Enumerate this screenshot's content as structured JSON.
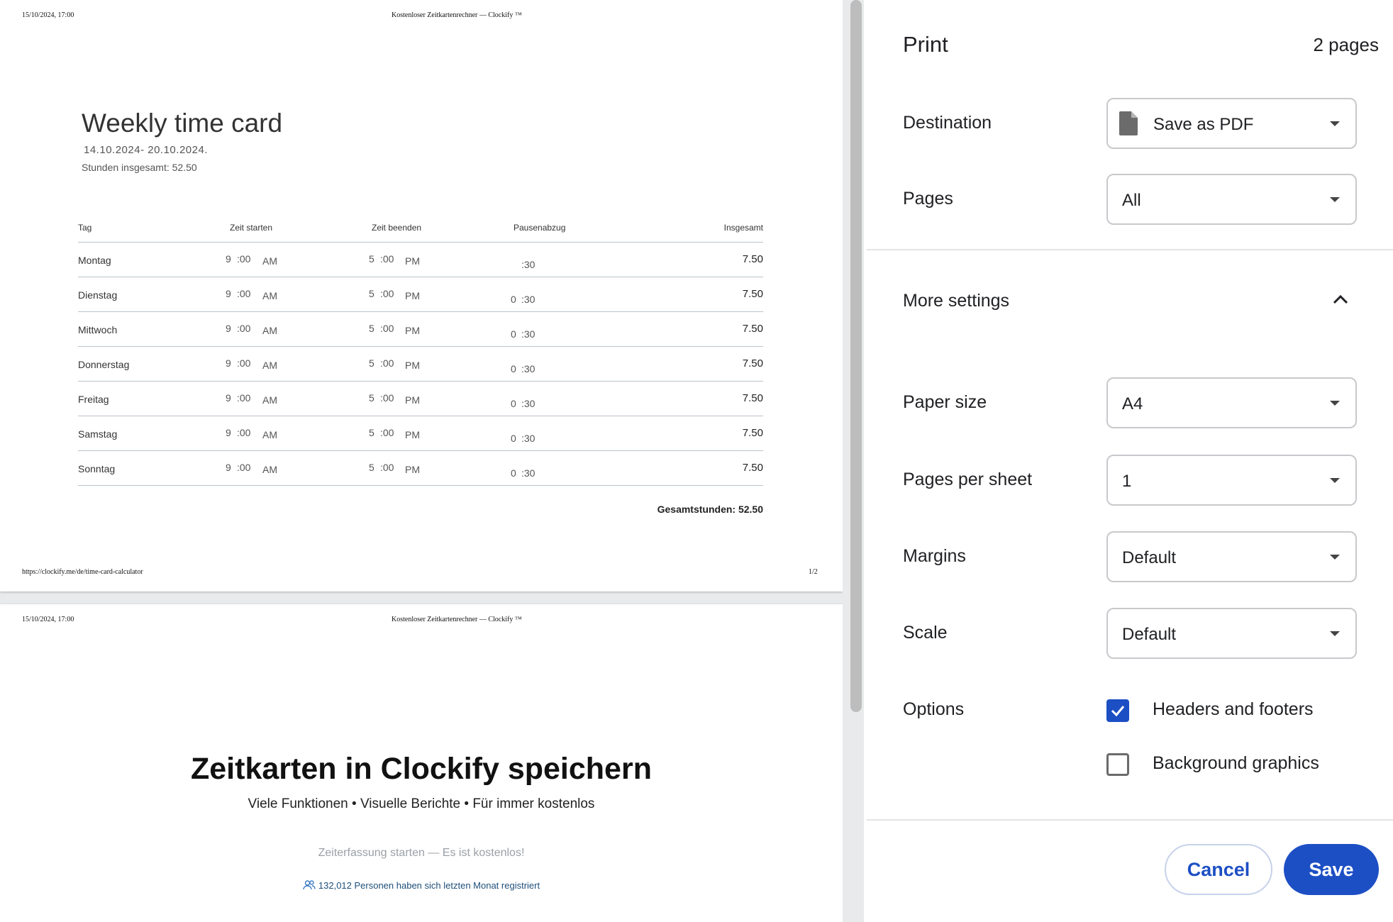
{
  "page1": {
    "header_date": "15/10/2024, 17:00",
    "header_title": "Kostenloser Zeitkartenrechner — Clockify ™",
    "footer_url": "https://clockify.me/de/time-card-calculator",
    "footer_page": "1/2",
    "title": "Weekly time card",
    "dates": "14.10.2024- 20.10.2024.",
    "hours_total": "Stunden insgesamt: 52.50",
    "columns": [
      "Tag",
      "Zeit starten",
      "Zeit beenden",
      "Pausenabzug",
      "Insgesamt"
    ],
    "rows": [
      {
        "day": "Montag",
        "start_h": "9",
        "start_m": ":00",
        "start_ap": "AM",
        "end_h": "5",
        "end_m": ":00",
        "end_ap": "PM",
        "break_h": "",
        "break_m": ":30",
        "total": "7.50"
      },
      {
        "day": "Dienstag",
        "start_h": "9",
        "start_m": ":00",
        "start_ap": "AM",
        "end_h": "5",
        "end_m": ":00",
        "end_ap": "PM",
        "break_h": "0",
        "break_m": ":30",
        "total": "7.50"
      },
      {
        "day": "Mittwoch",
        "start_h": "9",
        "start_m": ":00",
        "start_ap": "AM",
        "end_h": "5",
        "end_m": ":00",
        "end_ap": "PM",
        "break_h": "0",
        "break_m": ":30",
        "total": "7.50"
      },
      {
        "day": "Donnerstag",
        "start_h": "9",
        "start_m": ":00",
        "start_ap": "AM",
        "end_h": "5",
        "end_m": ":00",
        "end_ap": "PM",
        "break_h": "0",
        "break_m": ":30",
        "total": "7.50"
      },
      {
        "day": "Freitag",
        "start_h": "9",
        "start_m": ":00",
        "start_ap": "AM",
        "end_h": "5",
        "end_m": ":00",
        "end_ap": "PM",
        "break_h": "0",
        "break_m": ":30",
        "total": "7.50"
      },
      {
        "day": "Samstag",
        "start_h": "9",
        "start_m": ":00",
        "start_ap": "AM",
        "end_h": "5",
        "end_m": ":00",
        "end_ap": "PM",
        "break_h": "0",
        "break_m": ":30",
        "total": "7.50"
      },
      {
        "day": "Sonntag",
        "start_h": "9",
        "start_m": ":00",
        "start_ap": "AM",
        "end_h": "5",
        "end_m": ":00",
        "end_ap": "PM",
        "break_h": "0",
        "break_m": ":30",
        "total": "7.50"
      }
    ],
    "grand_total": "Gesamtstunden: 52.50"
  },
  "page2": {
    "header_date": "15/10/2024, 17:00",
    "header_title": "Kostenloser Zeitkartenrechner — Clockify ™",
    "title": "Zeitkarten in Clockify speichern",
    "subtitle": "Viele Funktionen • Visuelle Berichte • Für immer kostenlos",
    "cta": "Zeiterfassung starten — Es ist kostenlos!",
    "registered": "132,012 Personen haben sich letzten Monat registriert",
    "users_icon": "users-icon"
  },
  "panel": {
    "title": "Print",
    "pages_count": "2 pages",
    "destination_label": "Destination",
    "destination_value": "Save as PDF",
    "destination_icon": "document-icon",
    "pages_label": "Pages",
    "pages_value": "All",
    "more_settings_label": "More settings",
    "more_settings_icon": "chevron-up-icon",
    "paper_size_label": "Paper size",
    "paper_size_value": "A4",
    "pages_per_sheet_label": "Pages per sheet",
    "pages_per_sheet_value": "1",
    "margins_label": "Margins",
    "margins_value": "Default",
    "scale_label": "Scale",
    "scale_value": "Default",
    "options_label": "Options",
    "option_headers": "Headers and footers",
    "option_headers_checked": true,
    "option_background": "Background graphics",
    "option_background_checked": false,
    "cancel_label": "Cancel",
    "save_label": "Save",
    "accent_color": "#1d4fc4"
  }
}
